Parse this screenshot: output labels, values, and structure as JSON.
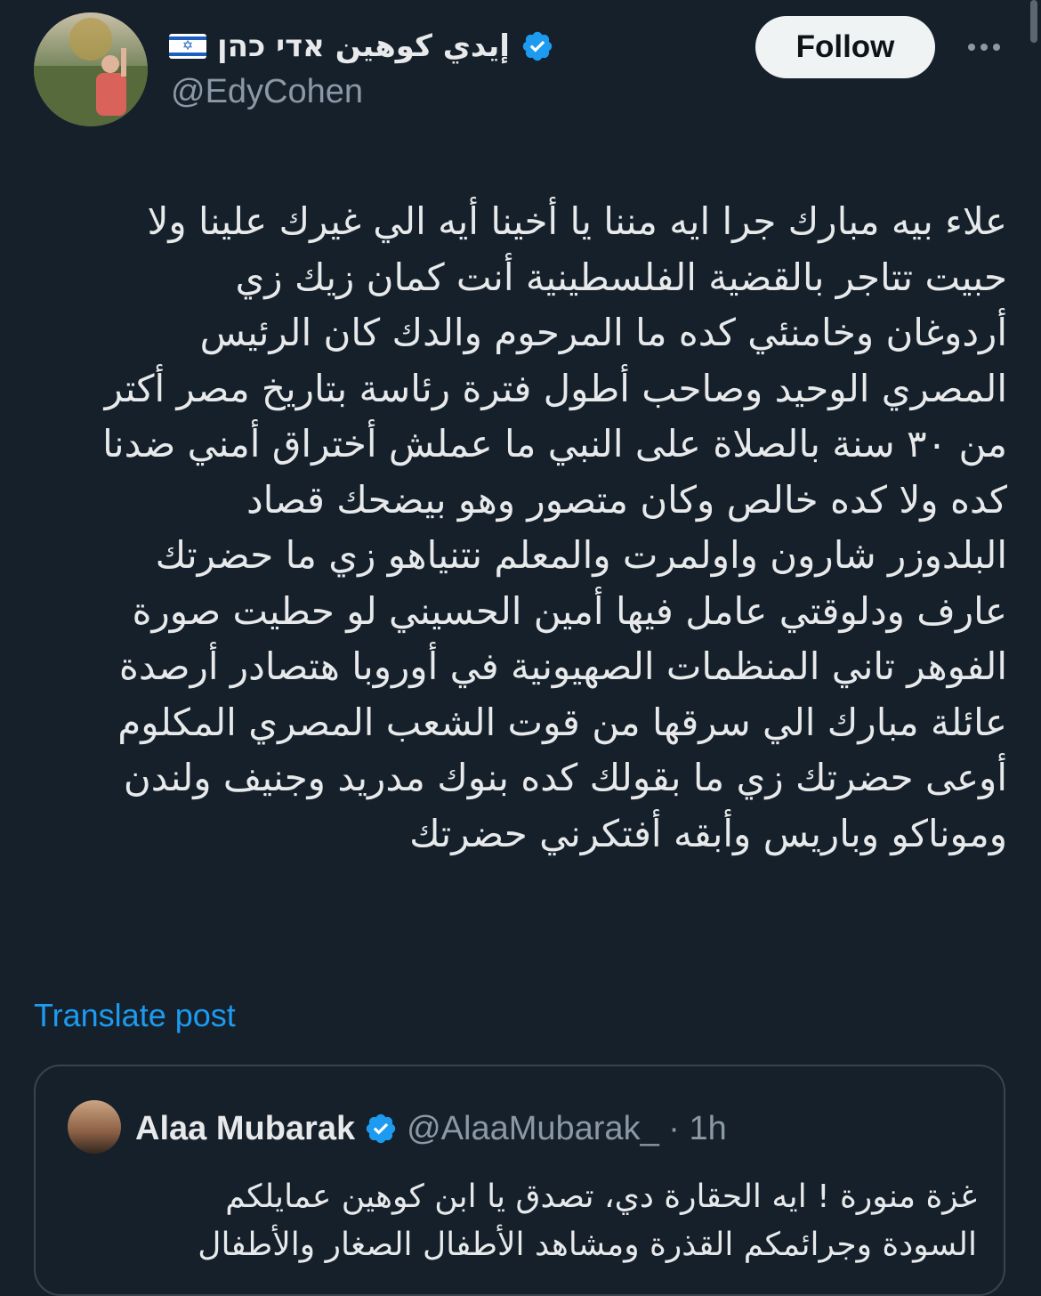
{
  "author": {
    "display_name": "إيدي كوهين אדי כהן",
    "flag_emoji": "israel-flag",
    "handle": "@EdyCohen",
    "verified": true
  },
  "actions": {
    "follow_label": "Follow",
    "more_icon": "more-horizontal-icon"
  },
  "post": {
    "lines": [
      "علاء بيه مبارك جرا ايه مننا يا أخينا أيه الي غيرك علينا ولا",
      "حبيت تتاجر بالقضية الفلسطينية أنت كمان زيك زي",
      "أردوغان وخامنئي كده ما المرحوم والدك كان الرئيس",
      "المصري الوحيد وصاحب أطول فترة رئاسة بتاريخ مصر أكتر",
      "من ٣٠ سنة بالصلاة على النبي ما عملش أختراق أمني ضدنا",
      "كده ولا كده خالص وكان متصور وهو بيضحك قصاد",
      "البلدوزر شارون واولمرت والمعلم نتنياهو زي ما حضرتك",
      "عارف ودلوقتي عامل فيها أمين الحسيني لو حطيت صورة",
      "الفوهر تاني المنظمات الصهيونية في أوروبا هتصادر أرصدة",
      "عائلة مبارك الي سرقها من قوت الشعب المصري المكلوم",
      "أوعى حضرتك زي ما بقولك كده بنوك مدريد وجنيف ولندن",
      "وموناكو وباريس وأبقه أفتكرني حضرتك"
    ],
    "translate_label": "Translate post"
  },
  "quoted_post": {
    "display_name": "Alaa Mubarak",
    "handle_time": "@AlaaMubarak_ · 1h",
    "verified": true,
    "lines": [
      "غزة منورة ! ايه الحقارة دي، تصدق يا ابن كوهين عمايلكم",
      "السودة وجرائمكم القذرة ومشاهد الأطفال الصغار والأطفال"
    ]
  },
  "colors": {
    "background": "#15202b",
    "text": "#e7e9ea",
    "secondary_text": "#8b98a5",
    "link": "#1d9bf0",
    "verified_badge": "#1d9bf0",
    "follow_button_bg": "#eff3f4"
  }
}
